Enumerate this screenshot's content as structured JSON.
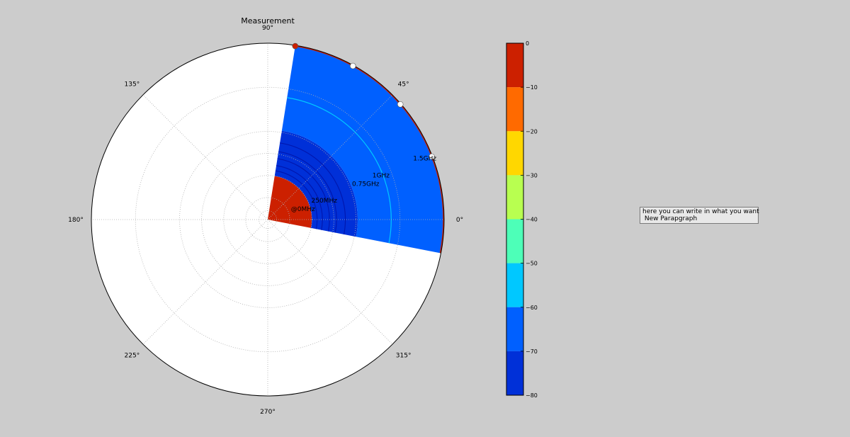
{
  "chart_data": {
    "type": "polar-contour",
    "title": "Measurement",
    "angle_unit": "degrees",
    "angular_ticks": [
      {
        "deg": 0,
        "label": "0°"
      },
      {
        "deg": 45,
        "label": "45°"
      },
      {
        "deg": 90,
        "label": "90°"
      },
      {
        "deg": 135,
        "label": "135°"
      },
      {
        "deg": 180,
        "label": "180°"
      },
      {
        "deg": 225,
        "label": "225°"
      },
      {
        "deg": 270,
        "label": "270°"
      },
      {
        "deg": 315,
        "label": "315°"
      }
    ],
    "radial_unit": "MHz",
    "radial_max": 2000,
    "radial_gridlines": [
      100,
      250,
      500,
      750,
      1000,
      1500
    ],
    "radial_labels": [
      {
        "r": 250,
        "label": "@0MHz"
      },
      {
        "r": 500,
        "label": "250MHz"
      },
      {
        "r": 1000,
        "label": "0.75GHz"
      },
      {
        "r": 1250,
        "label": "1GHz"
      },
      {
        "r": 1750,
        "label": "1.5GHz"
      }
    ],
    "sector_deg": [
      -11,
      81
    ],
    "filled_regions": [
      {
        "r_from": 0,
        "r_to": 500,
        "level": -5,
        "color": "#cc2000"
      },
      {
        "r_from": 500,
        "r_to": 1020,
        "level": -75,
        "color": "#0030d8"
      },
      {
        "r_from": 1020,
        "r_to": 2000,
        "level": -65,
        "color": "#0060ff"
      }
    ],
    "contour_lines": [
      {
        "r": 560,
        "color": "#0018b0"
      },
      {
        "r": 620,
        "color": "#0018b0"
      },
      {
        "r": 700,
        "color": "#0018b0"
      },
      {
        "r": 780,
        "color": "#0018b0"
      },
      {
        "r": 880,
        "color": "#0018b0"
      },
      {
        "r": 1400,
        "color": "#00c8ff"
      }
    ],
    "edge_markers_deg": [
      81,
      61,
      41,
      21
    ],
    "colorbar": {
      "min": -80,
      "max": 0,
      "ticks": [
        0,
        -10,
        -20,
        -30,
        -40,
        -50,
        -60,
        -70,
        -80
      ],
      "levels": [
        {
          "from": 0,
          "to": -10,
          "color": "#cc2000"
        },
        {
          "from": -10,
          "to": -20,
          "color": "#ff6a00"
        },
        {
          "from": -20,
          "to": -30,
          "color": "#ffd700"
        },
        {
          "from": -30,
          "to": -40,
          "color": "#b8ff50"
        },
        {
          "from": -40,
          "to": -50,
          "color": "#4dffb8"
        },
        {
          "from": -50,
          "to": -60,
          "color": "#00c8ff"
        },
        {
          "from": -60,
          "to": -70,
          "color": "#0060ff"
        },
        {
          "from": -70,
          "to": -80,
          "color": "#0030d8"
        }
      ]
    }
  },
  "note": {
    "line1": "here you can write in what you want",
    "line2": " New Parapgraph"
  }
}
